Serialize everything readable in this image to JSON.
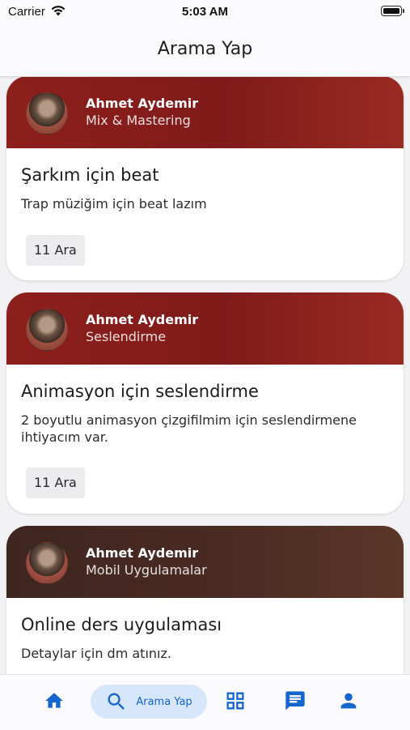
{
  "status": {
    "carrier": "Carrier",
    "time": "5:03 AM"
  },
  "header": {
    "title": "Arama Yap"
  },
  "colors": {
    "accent": "#1566cc",
    "card_red": "#8b1d1c",
    "card_brown": "#4a2a22"
  },
  "cards": [
    {
      "name": "Ahmet Aydemir",
      "category": "Mix & Mastering",
      "title": "Şarkım için beat",
      "description": "Trap müziğim için beat lazım",
      "date": "11 Ara"
    },
    {
      "name": "Ahmet Aydemir",
      "category": "Seslendirme",
      "title": "Animasyon için seslendirme",
      "description": "2 boyutlu animasyon çizgifilmim için seslendirmene ihtiyacım var.",
      "date": "11 Ara"
    },
    {
      "name": "Ahmet Aydemir",
      "category": "Mobil Uygulamalar",
      "title": "Online ders uygulaması",
      "description": "Detaylar için dm atınız."
    }
  ],
  "nav": {
    "items": [
      {
        "icon": "home-icon"
      },
      {
        "icon": "search-icon",
        "label": "Arama Yap"
      },
      {
        "icon": "grid-icon"
      },
      {
        "icon": "chat-icon"
      },
      {
        "icon": "person-icon"
      }
    ]
  }
}
